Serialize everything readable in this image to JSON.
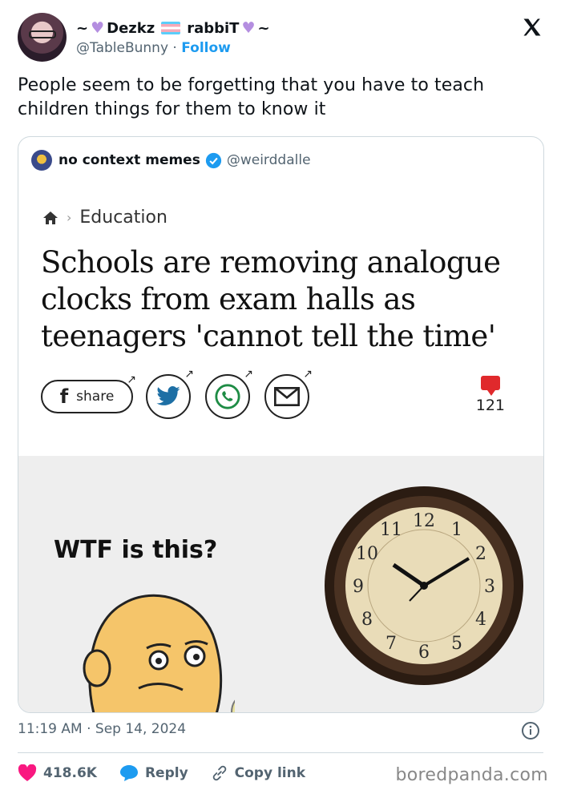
{
  "author": {
    "name_left": "~",
    "name_part1": "Dezkz",
    "name_part2": "rabbiT",
    "name_right": "~",
    "handle": "@TableBunny",
    "separator": "·",
    "follow_label": "Follow"
  },
  "tweet": {
    "text": "People seem to be forgetting that you have to teach children things for them to know it",
    "time": "11:19 AM · Sep 14, 2024"
  },
  "quoted": {
    "name": "no context memes",
    "handle": "@weirddalle",
    "breadcrumb": "Education",
    "headline": "Schools are removing analogue clocks from exam halls as teenagers 'cannot tell the time'",
    "share_label": "share",
    "comment_count": "121",
    "meme_caption": "WTF is this?",
    "clock_numbers": [
      "12",
      "1",
      "2",
      "3",
      "4",
      "5",
      "6",
      "7",
      "8",
      "9",
      "10",
      "11"
    ]
  },
  "actions": {
    "likes": "418.6K",
    "reply_label": "Reply",
    "copy_label": "Copy link"
  },
  "watermark": "boredpanda.com",
  "colors": {
    "accent": "#1d9bf0",
    "like": "#f91880",
    "heart_emoji": "#b48ee0",
    "comment": "#e0292c"
  }
}
